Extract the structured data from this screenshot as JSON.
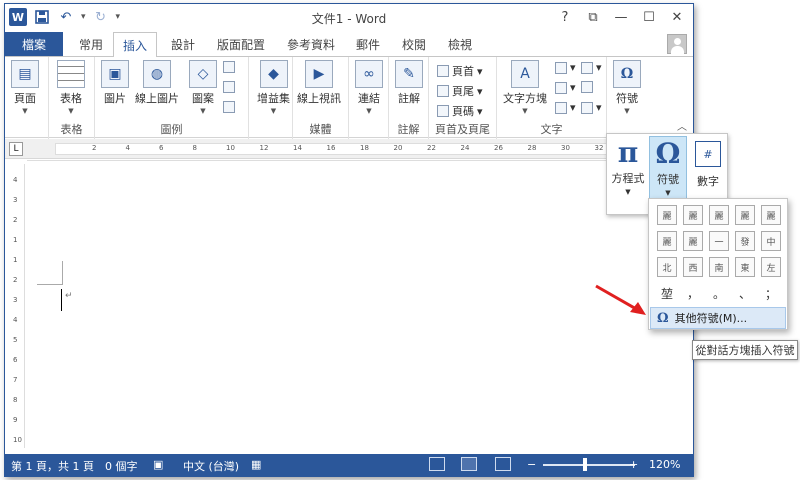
{
  "app": {
    "title": "文件1 - Word",
    "logo": "W"
  },
  "quick_access": {
    "save_icon": "save-icon",
    "undo_icon": "undo-icon",
    "redo_icon": "redo-icon"
  },
  "window_controls": {
    "help": "?",
    "ribbon_options": "⧉",
    "minimize": "—",
    "maximize": "☐",
    "close": "✕"
  },
  "tabs": {
    "file": "檔案",
    "items": [
      "常用",
      "插入",
      "設計",
      "版面配置",
      "參考資料",
      "郵件",
      "校閱",
      "檢視"
    ],
    "active": "插入"
  },
  "ribbon": {
    "groups": [
      {
        "label": "",
        "buttons": [
          {
            "label": "頁面"
          }
        ]
      },
      {
        "label": "表格",
        "buttons": [
          {
            "label": "表格"
          }
        ]
      },
      {
        "label": "圖例",
        "buttons": [
          {
            "label": "圖片"
          },
          {
            "label": "線上圖片"
          },
          {
            "label": "圖案"
          }
        ]
      },
      {
        "label": "",
        "buttons": [
          {
            "label": "增益集"
          }
        ]
      },
      {
        "label": "媒體",
        "buttons": [
          {
            "label": "線上視訊"
          }
        ]
      },
      {
        "label": "",
        "buttons": [
          {
            "label": "連結"
          }
        ]
      },
      {
        "label": "註解",
        "buttons": [
          {
            "label": "註解"
          }
        ]
      },
      {
        "label": "頁首及頁尾",
        "buttons": [
          {
            "label": "頁首"
          },
          {
            "label": "頁尾"
          },
          {
            "label": "頁碼"
          }
        ]
      },
      {
        "label": "文字",
        "buttons": [
          {
            "label": "文字方塊"
          }
        ]
      },
      {
        "label": "",
        "buttons": [
          {
            "label": "符號"
          }
        ]
      }
    ]
  },
  "ruler": {
    "ticks": [
      "2",
      "4",
      "6",
      "8",
      "10",
      "12",
      "14",
      "16",
      "18",
      "20",
      "22",
      "24",
      "26",
      "28",
      "30",
      "32"
    ],
    "vertical": [
      "4",
      "3",
      "2",
      "1",
      "1",
      "2",
      "3",
      "4",
      "5",
      "6",
      "7",
      "8",
      "9",
      "10"
    ]
  },
  "symbol_gallery": {
    "equation": {
      "glyph": "π",
      "label": "方程式"
    },
    "symbol": {
      "glyph": "Ω",
      "label": "符號"
    },
    "number": {
      "glyph": "#",
      "label": "數字"
    }
  },
  "symbol_panel": {
    "row1": [
      "麗",
      "麗",
      "麗",
      "麗",
      "麗"
    ],
    "row2": [
      "麗",
      "麗",
      "一",
      "發",
      "中"
    ],
    "row3": [
      "北",
      "西",
      "南",
      "東",
      "左"
    ],
    "row4": [
      "堃",
      "，",
      "。",
      "、",
      "；"
    ],
    "more_label": "其他符號(M)...",
    "tooltip": "從對話方塊插入符號"
  },
  "status": {
    "page": "第 1 頁，共 1 頁",
    "words": "0 個字",
    "language": "中文 (台灣)",
    "zoom": "120%",
    "zoom_minus": "−",
    "zoom_plus": "+"
  },
  "colors": {
    "accent": "#2b579a",
    "arrow": "#e02020"
  }
}
